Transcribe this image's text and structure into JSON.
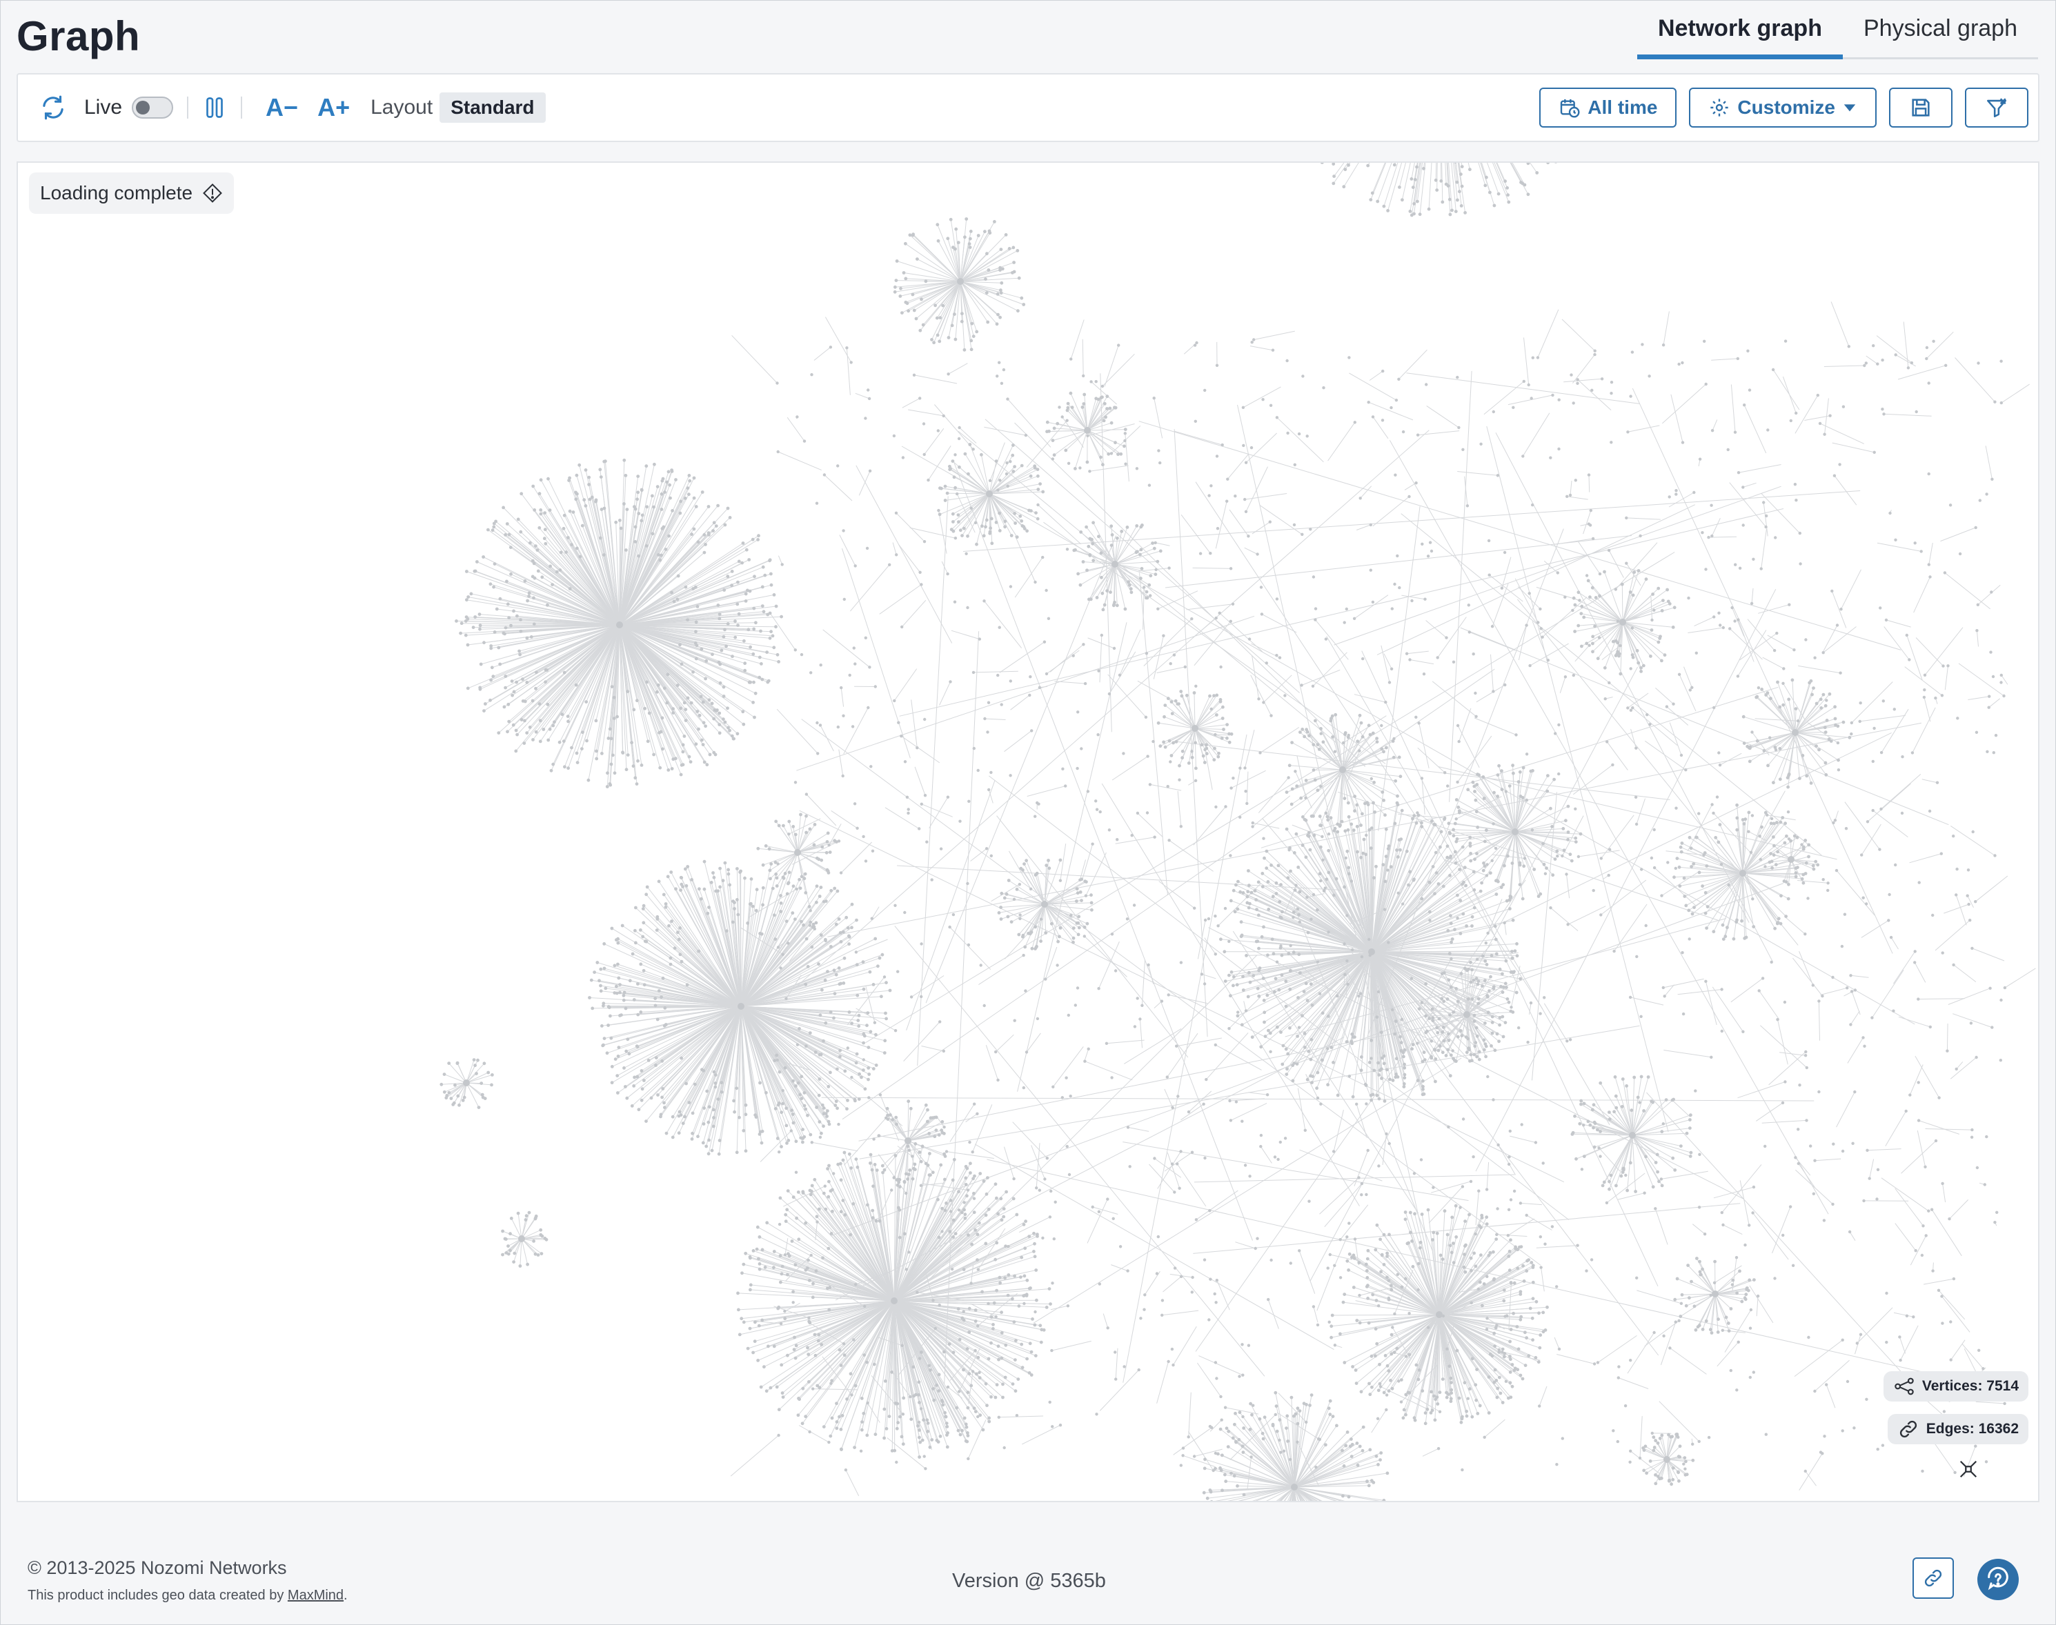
{
  "header": {
    "title": "Graph",
    "tabs": [
      {
        "label": "Network graph",
        "active": true
      },
      {
        "label": "Physical graph",
        "active": false
      }
    ]
  },
  "toolbar": {
    "live_label": "Live",
    "live_enabled": false,
    "font_decrease": "A−",
    "font_increase": "A+",
    "layout_label": "Layout",
    "layout_value": "Standard",
    "time_button": "All time",
    "customize_button": "Customize"
  },
  "canvas": {
    "loading_status": "Loading complete",
    "vertices": "Vertices: 7514",
    "edges": "Edges: 16362"
  },
  "footer": {
    "copyright": "© 2013-2025 Nozomi Networks",
    "geo_prefix": "This product includes geo data created by ",
    "geo_link": "MaxMind",
    "geo_suffix": ".",
    "version": "Version @ 5365b"
  },
  "colors": {
    "accent": "#2e7dc1",
    "button_border": "#2e6fa8",
    "graph_line": "#d6d8db",
    "graph_node": "#c4c7cb"
  },
  "icons": [
    "refresh-icon",
    "pause-icon",
    "font-decrease-icon",
    "font-increase-icon",
    "calendar-clock-icon",
    "gear-icon",
    "caret-down-icon",
    "save-icon",
    "filter-clear-icon",
    "info-diamond-icon",
    "vertices-icon",
    "edges-link-icon",
    "fit-view-icon",
    "link-icon",
    "help-icon"
  ]
}
